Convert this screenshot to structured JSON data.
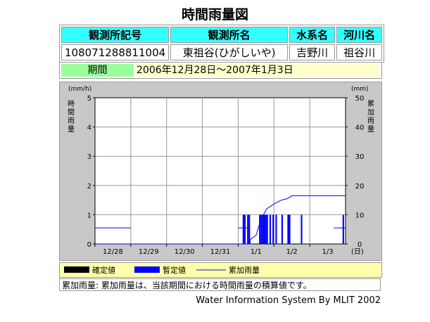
{
  "page_title": "時間雨量図",
  "station": {
    "headers": [
      "観測所記号",
      "観測所名",
      "水系名",
      "河川名"
    ],
    "values": [
      "108071288811004",
      "東祖谷(ひがしいや)",
      "吉野川",
      "祖谷川"
    ]
  },
  "period": {
    "label": "期間",
    "value": "2006年12月28日～2007年1月3日"
  },
  "legend": {
    "confirmed": "確定値",
    "provisional": "暫定値",
    "cumulative": "累加雨量"
  },
  "note": "累加雨量: 累加雨量は、当該期間における時間雨量の積算値です。",
  "footer": "Water Information System By MLIT 2002",
  "colors": {
    "confirmed": "#000000",
    "provisional": "#0000ff",
    "cumulative": "#0000ff",
    "plot_bg": "#ffffff",
    "frame_bg": "#c8c8c8"
  },
  "chart_data": {
    "type": "bar",
    "left_axis": {
      "unit_label": "(mm/h)",
      "title": "時間雨量",
      "ticks": [
        "0",
        "1",
        "2",
        "3",
        "4",
        "5"
      ],
      "range": [
        0,
        5
      ]
    },
    "right_axis": {
      "unit_label": "(mm)",
      "title": "累加雨量",
      "ticks": [
        "0",
        "10",
        "20",
        "30",
        "40",
        "50"
      ],
      "range": [
        0,
        50
      ]
    },
    "x_axis": {
      "ticks": [
        "12/28",
        "12/29",
        "12/30",
        "12/31",
        "1/1",
        "1/2",
        "1/3"
      ],
      "unit_label": "(日)",
      "hours": 168
    },
    "hourly_provisional": [
      {
        "hour": 99,
        "value": 1.0
      },
      {
        "hour": 100,
        "value": 1.0
      },
      {
        "hour": 102,
        "value": 1.0
      },
      {
        "hour": 103,
        "value": 1.0
      },
      {
        "hour": 110,
        "value": 1.0
      },
      {
        "hour": 111,
        "value": 1.0
      },
      {
        "hour": 112,
        "value": 1.0
      },
      {
        "hour": 113,
        "value": 1.0
      },
      {
        "hour": 114,
        "value": 1.0
      },
      {
        "hour": 115,
        "value": 1.0
      },
      {
        "hour": 117,
        "value": 1.0
      },
      {
        "hour": 119,
        "value": 1.0
      },
      {
        "hour": 121,
        "value": 1.0
      },
      {
        "hour": 125,
        "value": 1.0
      },
      {
        "hour": 129,
        "value": 1.0
      },
      {
        "hour": 130,
        "value": 1.0
      },
      {
        "hour": 138,
        "value": 1.0
      },
      {
        "hour": 166,
        "value": 1.0
      }
    ],
    "hourly_missing_marker": [
      {
        "from": 0,
        "to": 24,
        "value": 0.55
      },
      {
        "from": 96,
        "to": 104,
        "value": 0.55
      },
      {
        "from": 160,
        "to": 168,
        "value": 0.55
      }
    ],
    "cumulative": [
      {
        "hour": 0,
        "value": 0
      },
      {
        "hour": 104,
        "value": 0
      },
      {
        "hour": 104,
        "value": 1.5
      },
      {
        "hour": 108,
        "value": 3
      },
      {
        "hour": 111,
        "value": 8
      },
      {
        "hour": 115,
        "value": 12
      },
      {
        "hour": 121,
        "value": 14
      },
      {
        "hour": 125,
        "value": 15
      },
      {
        "hour": 129,
        "value": 15.5
      },
      {
        "hour": 132,
        "value": 16.5
      },
      {
        "hour": 168,
        "value": 16.5
      }
    ],
    "ylim_left": [
      0,
      5
    ],
    "ylim_right": [
      0,
      50
    ],
    "grid": true
  }
}
